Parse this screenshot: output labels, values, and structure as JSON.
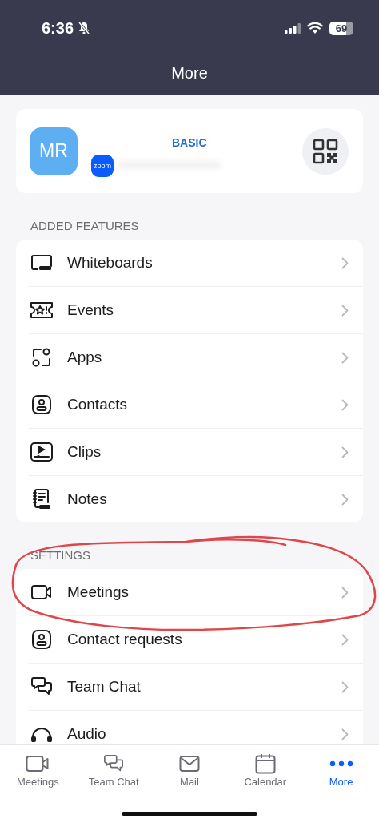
{
  "status_bar": {
    "time": "6:36",
    "battery": "69"
  },
  "header": {
    "title": "More"
  },
  "profile": {
    "initials": "MR",
    "app_badge": "zoom",
    "plan": "BASIC"
  },
  "sections": [
    {
      "title": "ADDED FEATURES",
      "items": [
        {
          "label": "Whiteboards"
        },
        {
          "label": "Events"
        },
        {
          "label": "Apps"
        },
        {
          "label": "Contacts"
        },
        {
          "label": "Clips"
        },
        {
          "label": "Notes"
        }
      ]
    },
    {
      "title": "SETTINGS",
      "items": [
        {
          "label": "Meetings"
        },
        {
          "label": "Contact requests"
        },
        {
          "label": "Team Chat"
        },
        {
          "label": "Audio"
        }
      ]
    }
  ],
  "tab_bar": [
    {
      "label": "Meetings",
      "selected": false
    },
    {
      "label": "Team Chat",
      "selected": false
    },
    {
      "label": "Mail",
      "selected": false
    },
    {
      "label": "Calendar",
      "selected": false
    },
    {
      "label": "More",
      "selected": true
    }
  ]
}
